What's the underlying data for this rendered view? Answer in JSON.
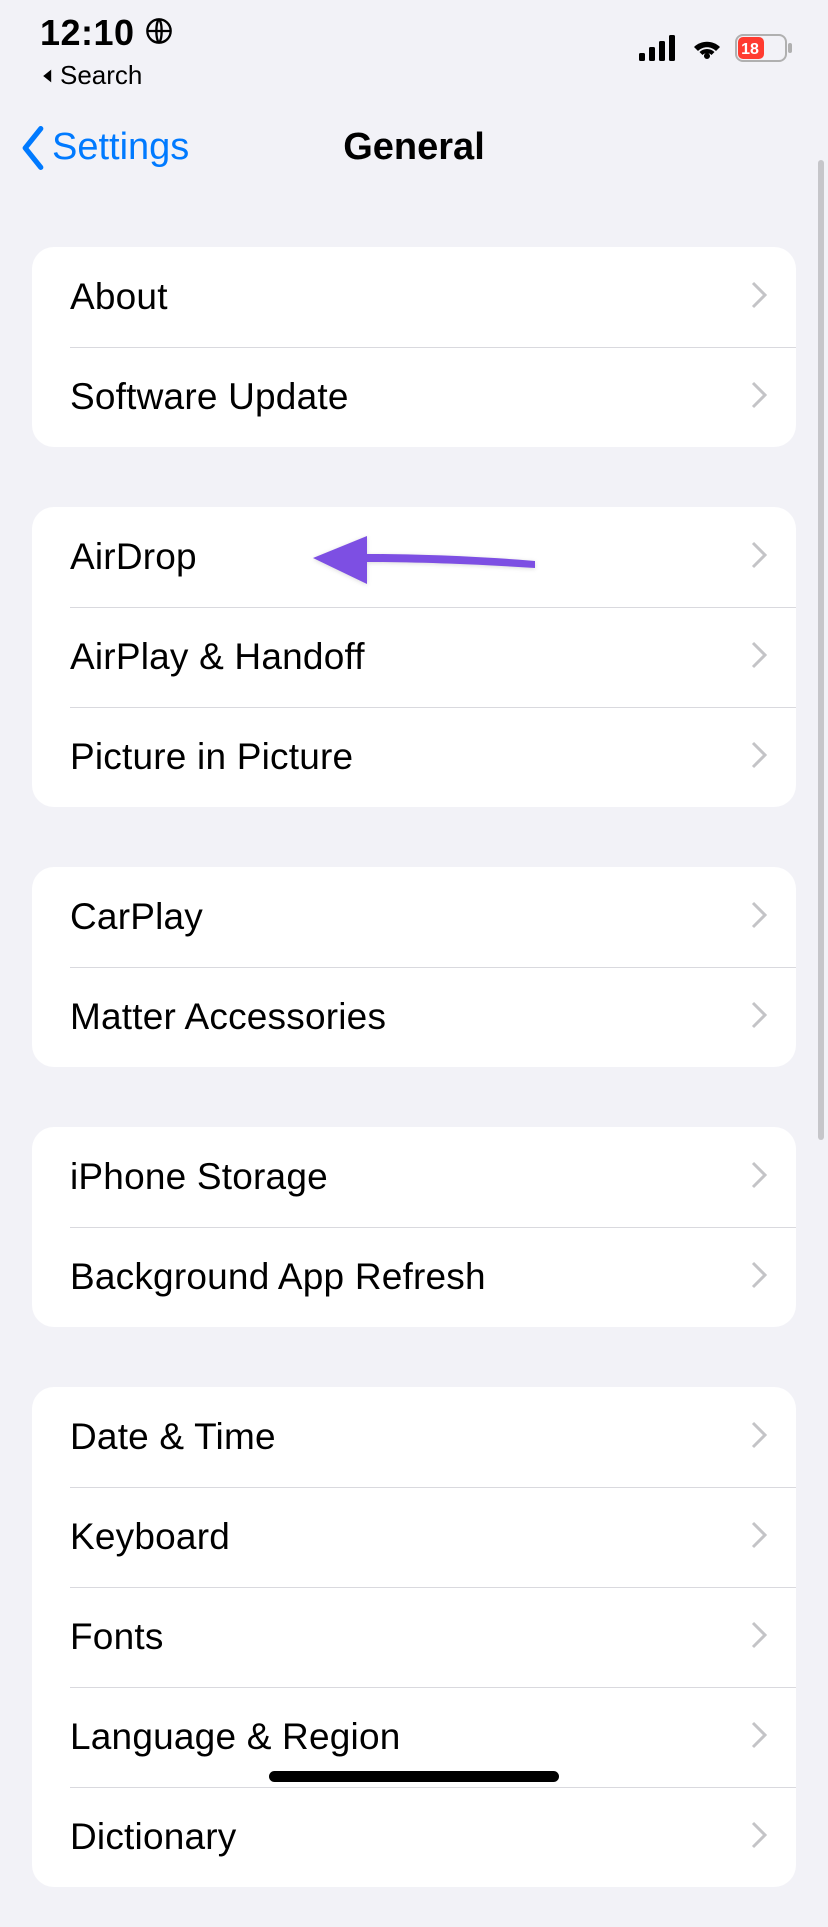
{
  "status": {
    "time": "12:10",
    "back_app": "Search",
    "battery_pct": "18"
  },
  "nav": {
    "back_label": "Settings",
    "title": "General"
  },
  "groups": [
    {
      "rows": [
        "About",
        "Software Update"
      ]
    },
    {
      "rows": [
        "AirDrop",
        "AirPlay & Handoff",
        "Picture in Picture"
      ]
    },
    {
      "rows": [
        "CarPlay",
        "Matter Accessories"
      ]
    },
    {
      "rows": [
        "iPhone Storage",
        "Background App Refresh"
      ]
    },
    {
      "rows": [
        "Date & Time",
        "Keyboard",
        "Fonts",
        "Language & Region",
        "Dictionary"
      ]
    }
  ],
  "annotation": {
    "color": "#7d4fe3",
    "target_row": "AirPlay & Handoff"
  }
}
